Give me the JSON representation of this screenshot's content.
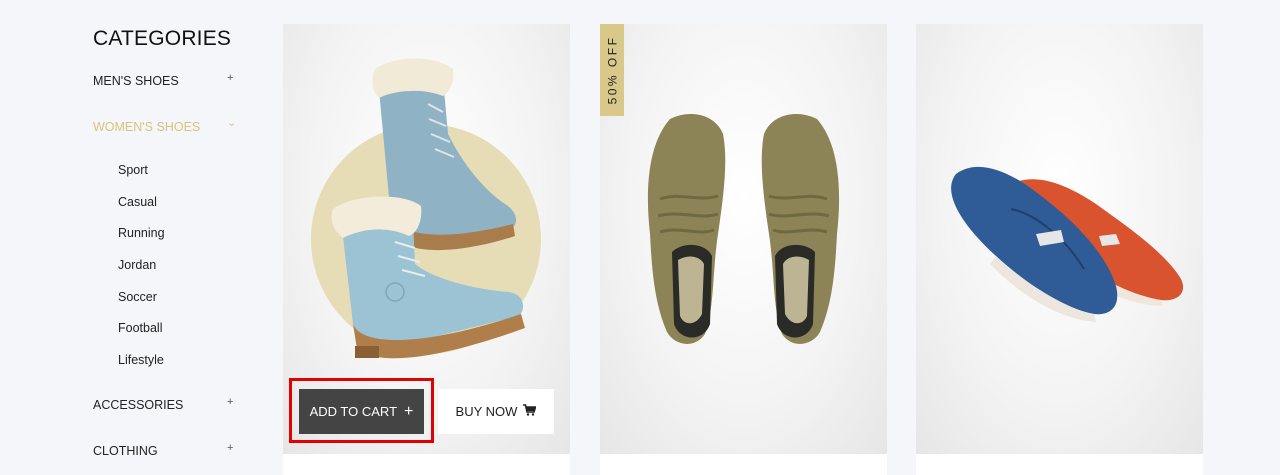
{
  "sidebar": {
    "heading": "CATEGORIES",
    "categories": [
      {
        "label": "MEN'S SHOES",
        "toggle": "+"
      },
      {
        "label": "WOMEN'S SHOES",
        "toggle": "⌄"
      },
      {
        "label": "ACCESSORIES",
        "toggle": "+"
      },
      {
        "label": "CLOTHING",
        "toggle": "+"
      }
    ],
    "subcategories": [
      "Sport",
      "Casual",
      "Running",
      "Jordan",
      "Soccer",
      "Football",
      "Lifestyle"
    ]
  },
  "products": [
    {
      "image": "blue-fur-boots",
      "add_to_cart": "ADD TO CART",
      "add_icon": "+",
      "buy_now": "BUY NOW",
      "cart_icon": "cart-icon"
    },
    {
      "image": "olive-suede-shoes",
      "badge": "50% OFF"
    },
    {
      "image": "blue-red-loafers"
    }
  ],
  "colors": {
    "accent": "#d8c47c",
    "badge": "#d8c98a",
    "button_dark": "#444444",
    "highlight": "#e30000"
  }
}
